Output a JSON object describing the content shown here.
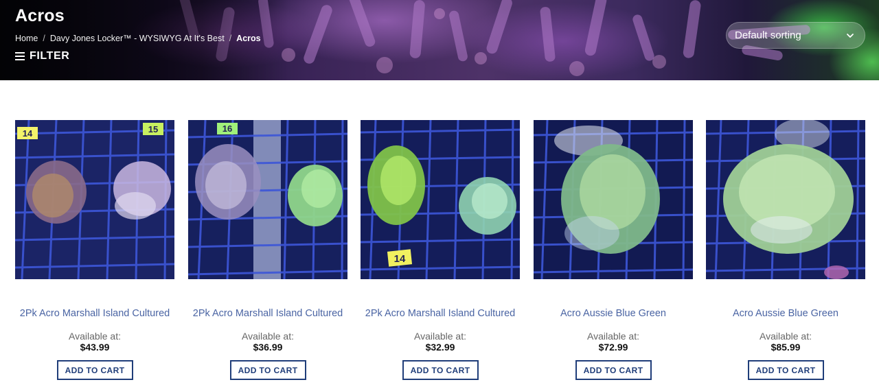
{
  "header": {
    "title": "Acros",
    "breadcrumb": [
      {
        "label": "Home"
      },
      {
        "label": "Davy Jones Locker™ - WYSIWYG At It's Best"
      },
      {
        "label": "Acros"
      }
    ],
    "filter_label": "FILTER",
    "sorting_value": "Default sorting"
  },
  "products": [
    {
      "name": "2Pk Acro Marshall Island Cultured",
      "availability": "Available at:",
      "price": "$43.99",
      "button": "ADD TO CART",
      "tags": [
        "14",
        "15"
      ]
    },
    {
      "name": "2Pk Acro Marshall Island Cultured",
      "availability": "Available at:",
      "price": "$36.99",
      "button": "ADD TO CART",
      "tags": [
        "16"
      ]
    },
    {
      "name": "2Pk Acro Marshall Island Cultured",
      "availability": "Available at:",
      "price": "$32.99",
      "button": "ADD TO CART",
      "tags": [
        "14"
      ]
    },
    {
      "name": "Acro Aussie Blue Green",
      "availability": "Available at:",
      "price": "$72.99",
      "button": "ADD TO CART",
      "tags": []
    },
    {
      "name": "Acro Aussie Blue Green",
      "availability": "Available at:",
      "price": "$85.99",
      "button": "ADD TO CART",
      "tags": []
    }
  ],
  "colors": {
    "link": "#4a64a3",
    "button_border": "#1f3d79",
    "coral_green": "#9fe07a",
    "grid": "#2a3aa8"
  }
}
